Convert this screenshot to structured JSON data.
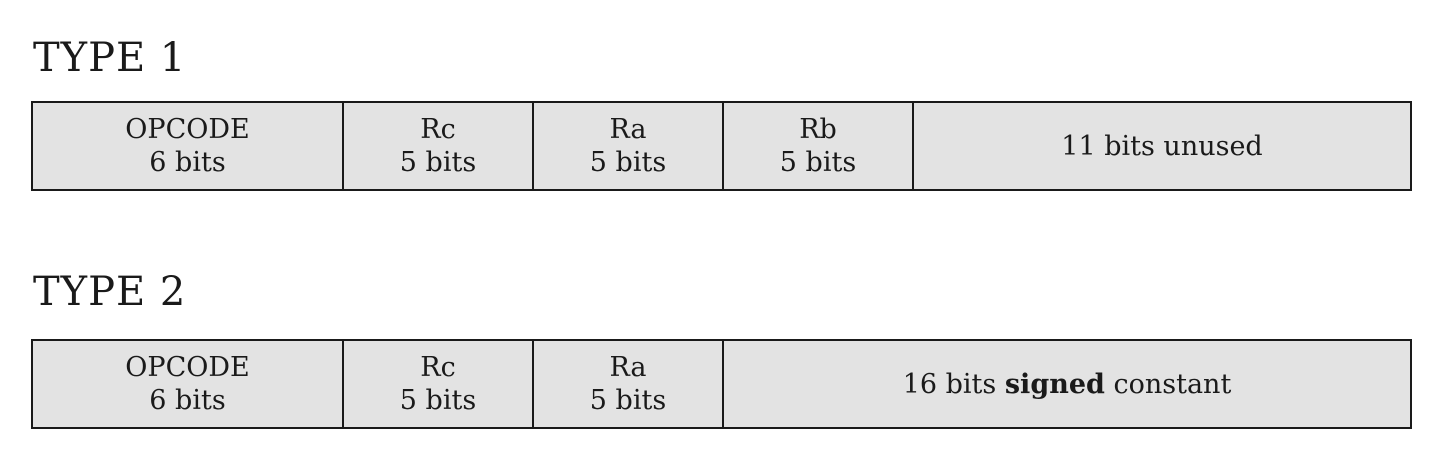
{
  "type1": {
    "heading": "TYPE 1",
    "fields": [
      {
        "name": "OPCODE",
        "bits": "6 bits"
      },
      {
        "name": "Rc",
        "bits": "5 bits"
      },
      {
        "name": "Ra",
        "bits": "5 bits"
      },
      {
        "name": "Rb",
        "bits": "5 bits"
      }
    ],
    "unused": "11 bits unused"
  },
  "type2": {
    "heading": "TYPE 2",
    "fields": [
      {
        "name": "OPCODE",
        "bits": "6 bits"
      },
      {
        "name": "Rc",
        "bits": "5 bits"
      },
      {
        "name": "Ra",
        "bits": "5 bits"
      }
    ],
    "constant": {
      "prefix": "16 bits",
      "emphasis": "signed",
      "suffix": "constant"
    }
  }
}
